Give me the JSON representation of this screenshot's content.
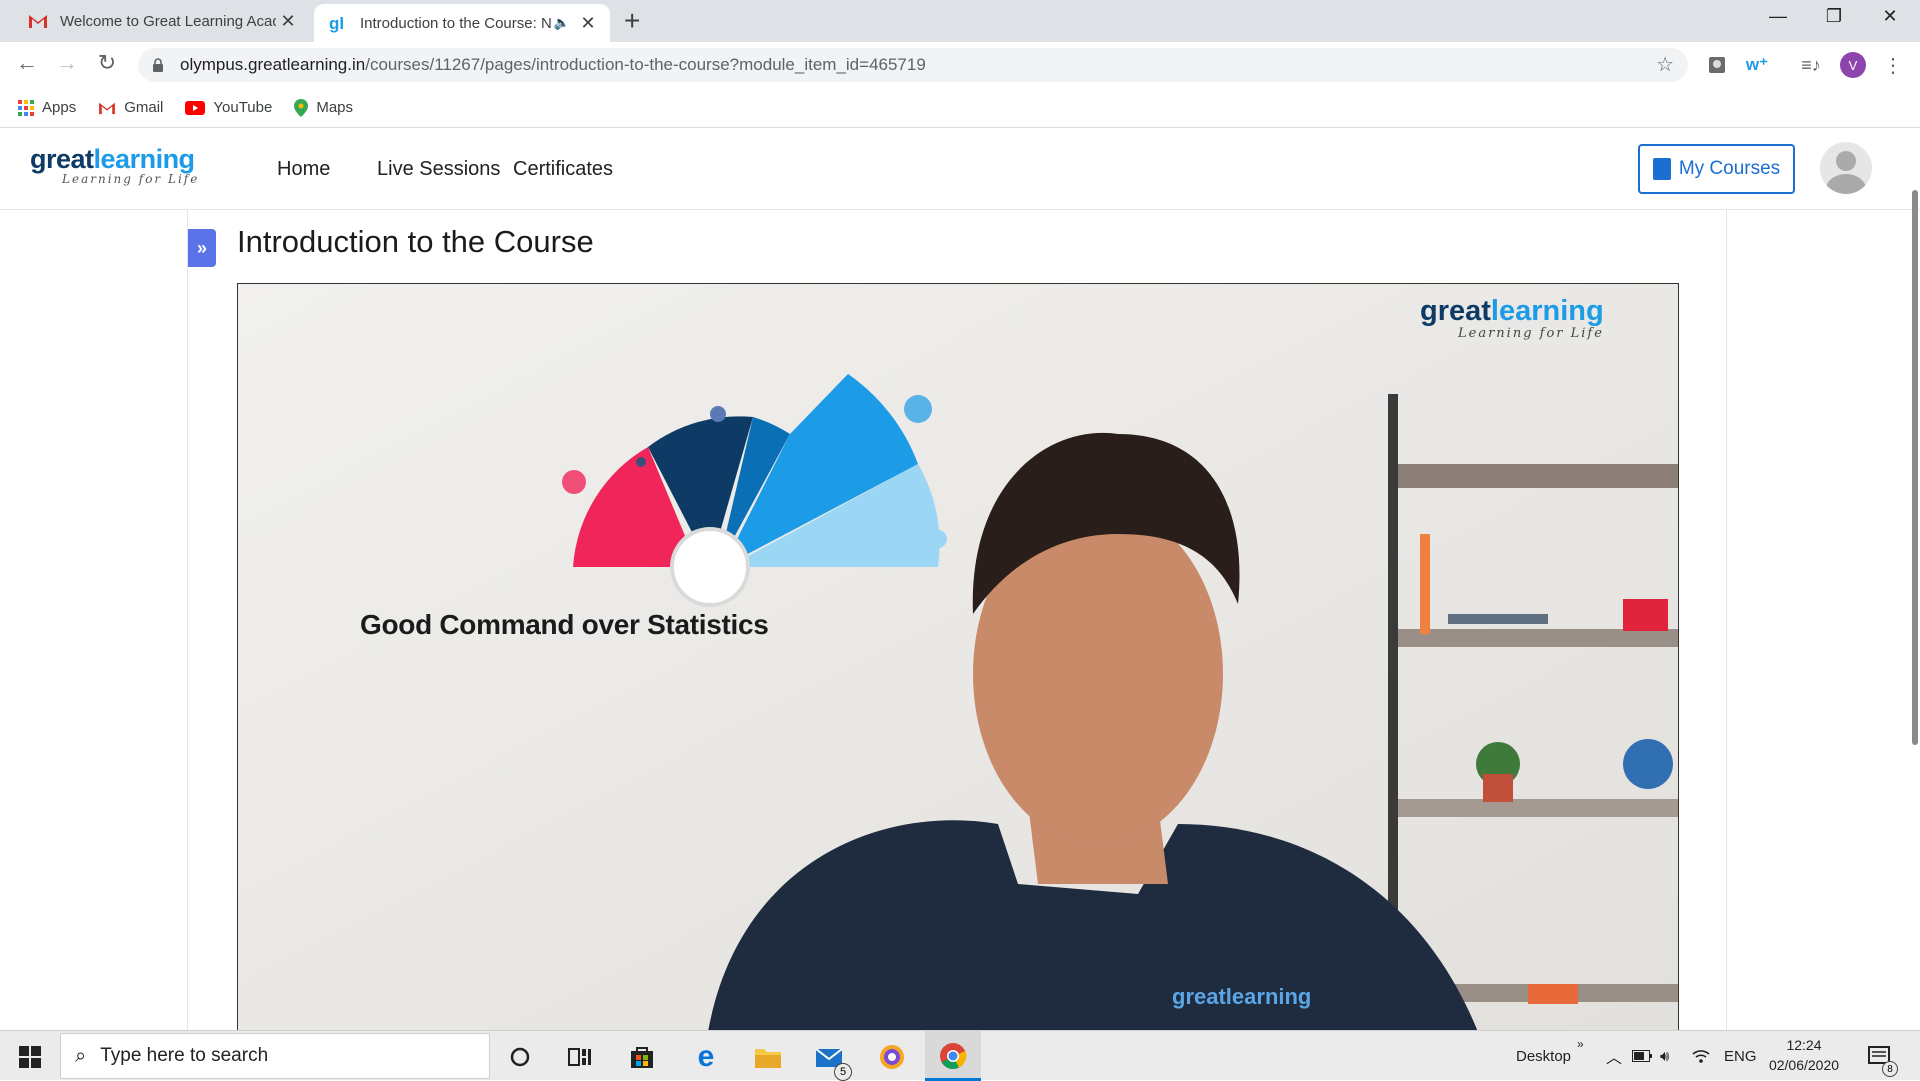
{
  "browser": {
    "tabs": [
      {
        "title": "Welcome to Great Learning Acad",
        "favicon": "gmail-icon"
      },
      {
        "title": "Introduction to the Course: N",
        "favicon": "greatlearning-icon",
        "audio": "speaker-icon"
      }
    ],
    "new_tab_label": "+",
    "url_host": "olympus.greatlearning.in",
    "url_path": "/courses/11267/pages/introduction-to-the-course?module_item_id=465719",
    "profile_initial": "V",
    "bookmarks": [
      {
        "label": "Apps",
        "icon": "apps-grid-icon"
      },
      {
        "label": "Gmail",
        "icon": "gmail-icon"
      },
      {
        "label": "YouTube",
        "icon": "youtube-icon"
      },
      {
        "label": "Maps",
        "icon": "maps-pin-icon"
      }
    ]
  },
  "site": {
    "logo_great": "great",
    "logo_learning": "learning",
    "logo_tagline": "Learning for Life",
    "nav": [
      "Home",
      "Live Sessions",
      "Certificates"
    ],
    "my_courses": "My Courses"
  },
  "page": {
    "title": "Introduction to the Course",
    "toggle_glyph": "»"
  },
  "video": {
    "caption": "Good Command over Statistics",
    "watermark_great": "great",
    "watermark_learning": "learning",
    "watermark_tagline": "Learning for Life",
    "shirt_logo": "greatlearning"
  },
  "taskbar": {
    "search_placeholder": "Type here to search",
    "desktop_label": "Desktop",
    "language": "ENG",
    "time": "12:24",
    "date": "02/06/2020",
    "mail_badge": "5",
    "notification_badge": "8"
  },
  "colors": {
    "brand_dark": "#0d3b66",
    "brand_light": "#1c9be6",
    "accent_blue": "#1a6fd1",
    "sidebar_toggle": "#5a73e8"
  }
}
